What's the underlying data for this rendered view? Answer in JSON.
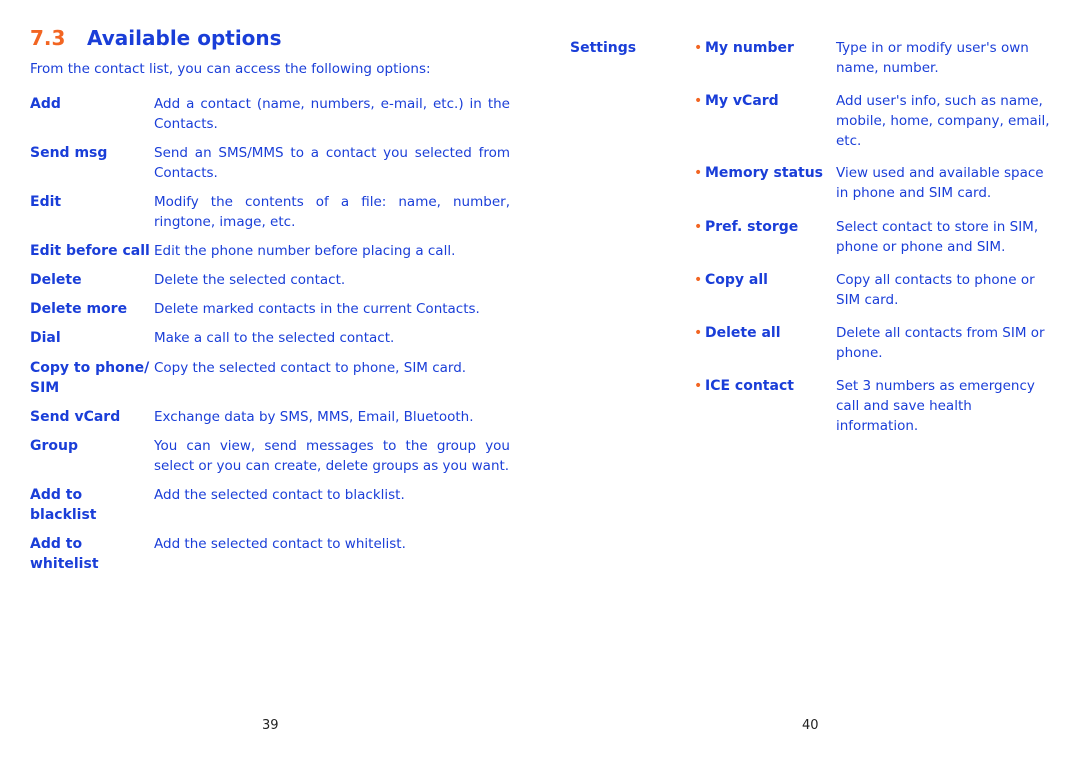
{
  "section": {
    "number": "7.3",
    "title": "Available options"
  },
  "intro": "From the contact list, you can access the following options:",
  "options": [
    {
      "term": "Add",
      "desc": "Add a contact (name, numbers, e-mail, etc.) in the Contacts."
    },
    {
      "term": "Send msg",
      "desc": "Send an SMS/MMS to a contact you selected from Contacts."
    },
    {
      "term": "Edit",
      "desc": "Modify the contents of a file: name, number, ringtone, image, etc."
    },
    {
      "term": "Edit before call",
      "desc": "Edit the phone number before placing a call."
    },
    {
      "term": "Delete",
      "desc": "Delete the selected contact."
    },
    {
      "term": "Delete more",
      "desc": "Delete marked contacts in the current Contacts."
    },
    {
      "term": "Dial",
      "desc": "Make a call to the selected contact."
    },
    {
      "term": "Copy to phone/ SIM",
      "desc": "Copy the selected contact to phone, SIM card."
    },
    {
      "term": "Send vCard",
      "desc": "Exchange data by SMS, MMS, Email, Bluetooth."
    },
    {
      "term": "Group",
      "desc": "You can view, send messages to the group you select or you can create, delete groups as you want."
    },
    {
      "term": "Add to blacklist",
      "desc": "Add the selected contact to blacklist."
    },
    {
      "term": "Add to whitelist",
      "desc": "Add the selected contact to whitelist."
    }
  ],
  "settings": {
    "label": "Settings",
    "items": [
      {
        "term": "My number",
        "desc": "Type in or modify user's own name, number."
      },
      {
        "term": "My vCard",
        "desc": "Add user's info, such as name, mobile, home, company, email, etc."
      },
      {
        "term": "Memory status",
        "desc": "View used and available space in phone and SIM card."
      },
      {
        "term": "Pref. storge",
        "desc": "Select contact to store in SIM, phone or phone and SIM."
      },
      {
        "term": "Copy all",
        "desc": "Copy all contacts to phone or SIM card."
      },
      {
        "term": "Delete all",
        "desc": "Delete all contacts from SIM or phone."
      },
      {
        "term": "ICE contact",
        "desc": "Set 3 numbers as emergency call and save health information."
      }
    ]
  },
  "pages": {
    "left": "39",
    "right": "40"
  },
  "colors": {
    "text": "#1a3ed8",
    "accent": "#f26522"
  }
}
